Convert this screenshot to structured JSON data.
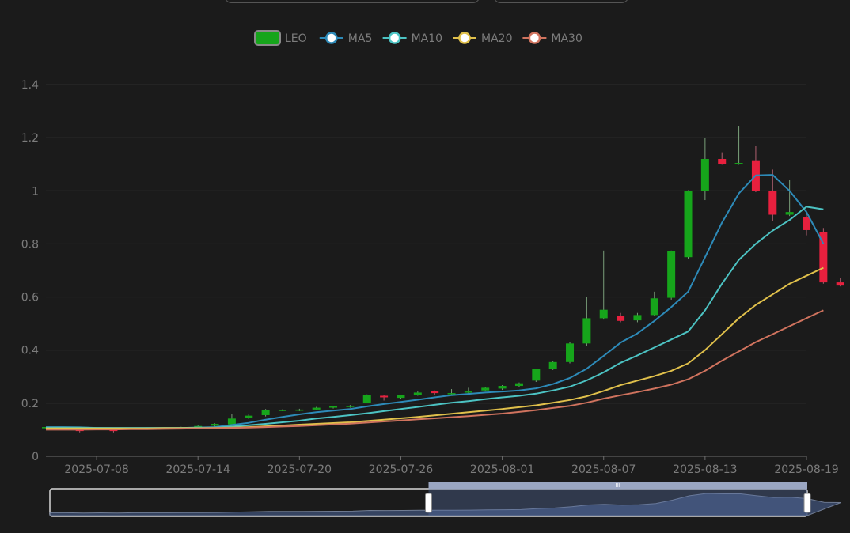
{
  "chart_data": {
    "type": "candlestick",
    "legend": {
      "position": "top-center",
      "items": [
        {
          "name": "LEO",
          "color": "#16a51b",
          "kind": "candle"
        },
        {
          "name": "MA5",
          "color": "#2d8ab8",
          "kind": "line"
        },
        {
          "name": "MA10",
          "color": "#4cc3c3",
          "kind": "line"
        },
        {
          "name": "MA20",
          "color": "#e0c04b",
          "kind": "line"
        },
        {
          "name": "MA30",
          "color": "#d0735e",
          "kind": "line"
        }
      ]
    },
    "colors": {
      "up": "#16a51b",
      "down": "#e8203e",
      "grid": "#2e2e2e",
      "axis_text": "#7c7c7c"
    },
    "y_axis": {
      "min": 0,
      "max": 1.4,
      "ticks": [
        "0",
        "0.2",
        "0.4",
        "0.6",
        "0.8",
        "1",
        "1.2",
        "1.4"
      ],
      "grid": true
    },
    "x_axis": {
      "tick_labels": [
        "2025-07-08",
        "2025-07-14",
        "2025-07-20",
        "2025-07-26",
        "2025-08-01",
        "2025-08-07",
        "2025-08-13",
        "2025-08-19"
      ]
    },
    "dates": [
      "2025-07-05",
      "2025-07-06",
      "2025-07-07",
      "2025-07-08",
      "2025-07-09",
      "2025-07-10",
      "2025-07-11",
      "2025-07-12",
      "2025-07-13",
      "2025-07-14",
      "2025-07-15",
      "2025-07-16",
      "2025-07-17",
      "2025-07-18",
      "2025-07-19",
      "2025-07-20",
      "2025-07-21",
      "2025-07-22",
      "2025-07-23",
      "2025-07-24",
      "2025-07-25",
      "2025-07-26",
      "2025-07-27",
      "2025-07-28",
      "2025-07-29",
      "2025-07-30",
      "2025-07-31",
      "2025-08-01",
      "2025-08-02",
      "2025-08-03",
      "2025-08-04",
      "2025-08-05",
      "2025-08-06",
      "2025-08-07",
      "2025-08-08",
      "2025-08-09",
      "2025-08-10",
      "2025-08-11",
      "2025-08-12",
      "2025-08-13",
      "2025-08-14",
      "2025-08-15",
      "2025-08-16",
      "2025-08-17",
      "2025-08-18",
      "2025-08-19"
    ],
    "ohlc": [
      [
        0.11,
        0.11,
        0.105,
        0.11
      ],
      [
        0.11,
        0.109,
        0.106,
        0.11
      ],
      [
        0.1,
        0.095,
        0.09,
        0.102
      ],
      [
        0.105,
        0.105,
        0.1,
        0.107
      ],
      [
        0.1,
        0.095,
        0.09,
        0.101
      ],
      [
        0.105,
        0.106,
        0.102,
        0.108
      ],
      [
        0.105,
        0.107,
        0.103,
        0.109
      ],
      [
        0.105,
        0.108,
        0.104,
        0.109
      ],
      [
        0.108,
        0.11,
        0.106,
        0.111
      ],
      [
        0.11,
        0.114,
        0.108,
        0.116
      ],
      [
        0.115,
        0.122,
        0.112,
        0.124
      ],
      [
        0.12,
        0.142,
        0.118,
        0.158
      ],
      [
        0.145,
        0.153,
        0.14,
        0.158
      ],
      [
        0.155,
        0.175,
        0.15,
        0.178
      ],
      [
        0.174,
        0.175,
        0.17,
        0.177
      ],
      [
        0.173,
        0.176,
        0.17,
        0.179
      ],
      [
        0.176,
        0.183,
        0.173,
        0.186
      ],
      [
        0.183,
        0.188,
        0.18,
        0.19
      ],
      [
        0.186,
        0.19,
        0.183,
        0.193
      ],
      [
        0.2,
        0.23,
        0.2,
        0.233
      ],
      [
        0.228,
        0.222,
        0.21,
        0.23
      ],
      [
        0.22,
        0.23,
        0.215,
        0.232
      ],
      [
        0.232,
        0.24,
        0.228,
        0.244
      ],
      [
        0.245,
        0.238,
        0.232,
        0.248
      ],
      [
        0.235,
        0.238,
        0.23,
        0.253
      ],
      [
        0.24,
        0.244,
        0.236,
        0.258
      ],
      [
        0.248,
        0.258,
        0.244,
        0.261
      ],
      [
        0.255,
        0.265,
        0.25,
        0.268
      ],
      [
        0.265,
        0.275,
        0.26,
        0.278
      ],
      [
        0.285,
        0.328,
        0.28,
        0.33
      ],
      [
        0.33,
        0.355,
        0.325,
        0.36
      ],
      [
        0.355,
        0.425,
        0.35,
        0.43
      ],
      [
        0.425,
        0.52,
        0.415,
        0.6
      ],
      [
        0.52,
        0.552,
        0.515,
        0.775
      ],
      [
        0.53,
        0.51,
        0.505,
        0.54
      ],
      [
        0.512,
        0.532,
        0.505,
        0.54
      ],
      [
        0.532,
        0.595,
        0.528,
        0.62
      ],
      [
        0.597,
        0.773,
        0.59,
        0.775
      ],
      [
        0.75,
        1.0,
        0.745,
        1.002
      ],
      [
        1.0,
        1.12,
        0.965,
        1.2
      ],
      [
        1.12,
        1.1,
        1.098,
        1.145
      ],
      [
        1.1,
        1.105,
        1.098,
        1.245
      ],
      [
        1.115,
        1.0,
        0.995,
        1.168
      ],
      [
        1.0,
        0.91,
        0.885,
        1.08
      ],
      [
        0.91,
        0.92,
        0.905,
        1.04
      ],
      [
        0.9,
        0.852,
        0.832,
        0.925
      ],
      [
        0.845,
        0.655,
        0.65,
        0.86
      ],
      [
        0.655,
        0.643,
        0.64,
        0.672
      ]
    ],
    "ma": {
      "MA5": [
        0.11,
        0.11,
        0.109,
        0.107,
        0.106,
        0.106,
        0.106,
        0.107,
        0.107,
        0.108,
        0.11,
        0.118,
        0.126,
        0.138,
        0.148,
        0.158,
        0.166,
        0.172,
        0.178,
        0.188,
        0.197,
        0.205,
        0.213,
        0.222,
        0.23,
        0.235,
        0.24,
        0.244,
        0.248,
        0.256,
        0.272,
        0.295,
        0.33,
        0.378,
        0.428,
        0.463,
        0.51,
        0.562,
        0.62,
        0.75,
        0.88,
        0.99,
        1.058,
        1.06,
        1.0,
        0.92,
        0.8
      ],
      "MA10": [
        0.108,
        0.108,
        0.108,
        0.107,
        0.107,
        0.107,
        0.107,
        0.107,
        0.107,
        0.108,
        0.108,
        0.112,
        0.117,
        0.122,
        0.128,
        0.134,
        0.142,
        0.148,
        0.155,
        0.162,
        0.17,
        0.178,
        0.186,
        0.194,
        0.202,
        0.208,
        0.215,
        0.222,
        0.228,
        0.236,
        0.248,
        0.262,
        0.286,
        0.316,
        0.352,
        0.38,
        0.41,
        0.44,
        0.47,
        0.55,
        0.65,
        0.74,
        0.8,
        0.85,
        0.89,
        0.94,
        0.93
      ],
      "MA20": [
        0.105,
        0.105,
        0.105,
        0.105,
        0.105,
        0.105,
        0.105,
        0.106,
        0.106,
        0.106,
        0.107,
        0.108,
        0.11,
        0.113,
        0.116,
        0.119,
        0.122,
        0.125,
        0.128,
        0.133,
        0.138,
        0.143,
        0.148,
        0.154,
        0.16,
        0.166,
        0.172,
        0.178,
        0.185,
        0.192,
        0.202,
        0.212,
        0.226,
        0.246,
        0.268,
        0.285,
        0.302,
        0.322,
        0.35,
        0.4,
        0.46,
        0.52,
        0.57,
        0.61,
        0.65,
        0.68,
        0.71
      ],
      "MA30": [
        0.1,
        0.1,
        0.1,
        0.101,
        0.101,
        0.102,
        0.102,
        0.103,
        0.104,
        0.105,
        0.106,
        0.107,
        0.108,
        0.11,
        0.112,
        0.114,
        0.117,
        0.12,
        0.123,
        0.127,
        0.131,
        0.135,
        0.139,
        0.143,
        0.147,
        0.151,
        0.156,
        0.161,
        0.167,
        0.174,
        0.182,
        0.19,
        0.202,
        0.217,
        0.23,
        0.242,
        0.255,
        0.27,
        0.29,
        0.322,
        0.36,
        0.395,
        0.43,
        0.46,
        0.49,
        0.52,
        0.55
      ]
    },
    "data_zoom": {
      "start_percent": 50,
      "end_percent": 100,
      "handle_label": "III"
    }
  }
}
